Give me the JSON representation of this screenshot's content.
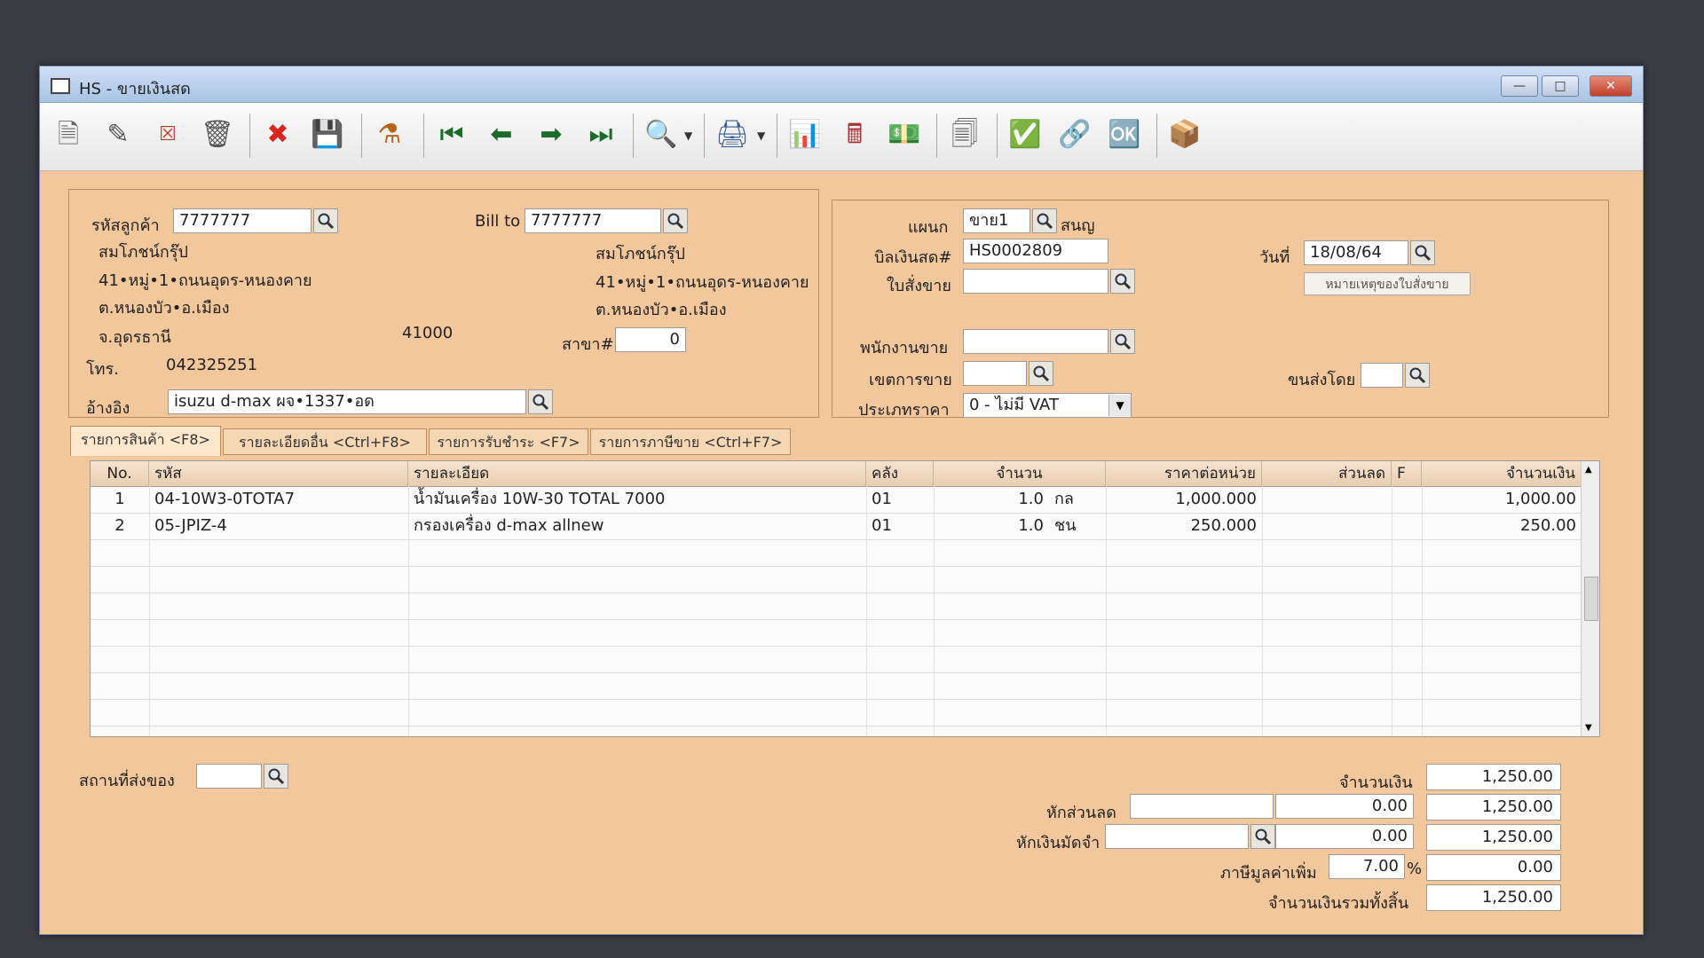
{
  "window": {
    "title": "HS - ขายเงินสด"
  },
  "toolbar": {
    "icons": [
      "new-document-icon",
      "edit-icon",
      "void-icon",
      "trash-icon",
      "cancel-icon",
      "save-icon",
      "approve-icon",
      "first-record-icon",
      "previous-record-icon",
      "next-record-icon",
      "last-record-icon",
      "search-icon",
      "print-icon",
      "report-icon",
      "calculator-icon",
      "money-icon",
      "receipt-icon",
      "approve-ok-icon",
      "link-icon",
      "confirm-ok-icon",
      "export-icon"
    ]
  },
  "customer": {
    "code_label": "รหัสลูกค้า",
    "code": "7777777",
    "bill_to_label": "Bill to",
    "bill_to": "7777777",
    "name": "สมโภชน์กรุ๊ป",
    "address1": "41•หมู่•1•ถนนอุดร-หนองคาย",
    "address2": "ต.หนองบัว•อ.เมือง",
    "province": "จ.อุดรธานี",
    "postcode": "41000",
    "bill_name": "สมโภชน์กรุ๊ป",
    "bill_address1": "41•หมู่•1•ถนนอุดร-หนองคาย",
    "bill_address2": "ต.หนองบัว•อ.เมือง",
    "branch_label": "สาขา#",
    "branch": "0",
    "phone_label": "โทร.",
    "phone": "042325251",
    "ref_label": "อ้างอิง",
    "ref": "isuzu d-max ผจ•1337•อด"
  },
  "document": {
    "dept_label": "แผนก",
    "dept": "ขาย1",
    "dept_name": "สนญ",
    "bill_label": "บิลเงินสด#",
    "bill_no": "HS0002809",
    "date_label": "วันที่",
    "date": "18/08/64",
    "order_label": "ใบสั่งขาย",
    "order_note_button": "หมายเหตุของใบสั่งขาย",
    "salesperson_label": "พนักงานขาย",
    "area_label": "เขตการขาย",
    "ship_by_label": "ขนส่งโดย",
    "price_type_label": "ประเภทราคา",
    "price_type": "0 - ไม่มี VAT"
  },
  "tabs": [
    {
      "label": "รายการสินค้า <F8>"
    },
    {
      "label": "รายละเอียดอื่น <Ctrl+F8>"
    },
    {
      "label": "รายการรับชำระ <F7>"
    },
    {
      "label": "รายการภาษีขาย <Ctrl+F7>"
    }
  ],
  "table": {
    "headers": [
      "No.",
      "รหัส",
      "รายละเอียด",
      "คลัง",
      "จำนวน",
      "ราคาต่อหน่วย",
      "ส่วนลด",
      "F",
      "จำนวนเงิน"
    ],
    "rows": [
      {
        "no": "1",
        "code": "04-10W3-0TOTA7",
        "desc": "น้ำมันเครื่อง 10W-30 TOTAL 7000",
        "wh": "01",
        "qty": "1.0",
        "unit": "กล",
        "price": "1,000.000",
        "disc": "",
        "f": "",
        "amount": "1,000.00"
      },
      {
        "no": "2",
        "code": "05-JPIZ-4",
        "desc": "กรองเครื่อง d-max allnew",
        "wh": "01",
        "qty": "1.0",
        "unit": "ชน",
        "price": "250.000",
        "disc": "",
        "f": "",
        "amount": "250.00"
      }
    ]
  },
  "footer": {
    "delivery_label": "สถานที่ส่งของ",
    "amount_label": "จำนวนเงิน",
    "amount": "1,250.00",
    "discount_label": "หักส่วนลด",
    "discount_value": "0.00",
    "after_discount": "1,250.00",
    "deposit_label": "หักเงินมัดจำ",
    "deposit_value": "0.00",
    "after_deposit": "1,250.00",
    "vat_label": "ภาษีมูลค่าเพิ่ม",
    "vat_rate": "7.00",
    "vat_pct": "%",
    "vat_amount": "0.00",
    "grand_total_label": "จำนวนเงินรวมทั้งสิ้น",
    "grand_total": "1,250.00"
  }
}
